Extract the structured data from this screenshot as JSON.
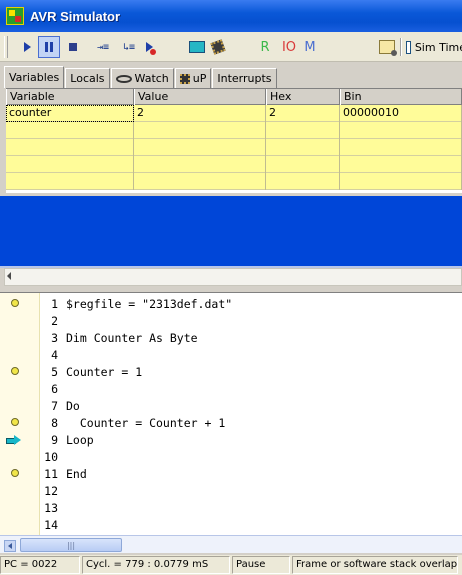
{
  "window": {
    "title": "AVR Simulator"
  },
  "toolbar": {
    "register_label": "R",
    "io_label": "IO",
    "memory_label": "M",
    "sim_time_label": "Sim Time"
  },
  "tabs": [
    {
      "label": "Variables"
    },
    {
      "label": "Locals"
    },
    {
      "label": "Watch"
    },
    {
      "label": "uP"
    },
    {
      "label": "Interrupts"
    }
  ],
  "grid": {
    "headers": [
      "Variable",
      "Value",
      "Hex",
      "Bin"
    ],
    "rows": [
      [
        "counter",
        "2",
        "2",
        "00000010"
      ]
    ]
  },
  "code": {
    "lines": [
      {
        "num": "1",
        "text": "$regfile = \"2313def.dat\""
      },
      {
        "num": "2",
        "text": ""
      },
      {
        "num": "3",
        "text": "Dim Counter As Byte"
      },
      {
        "num": "4",
        "text": ""
      },
      {
        "num": "5",
        "text": "Counter = 1"
      },
      {
        "num": "6",
        "text": ""
      },
      {
        "num": "7",
        "text": "Do"
      },
      {
        "num": "8",
        "text": "  Counter = Counter + 1"
      },
      {
        "num": "9",
        "text": "Loop"
      },
      {
        "num": "10",
        "text": ""
      },
      {
        "num": "11",
        "text": "End"
      },
      {
        "num": "12",
        "text": ""
      },
      {
        "num": "13",
        "text": ""
      },
      {
        "num": "14",
        "text": ""
      }
    ]
  },
  "statusbar": {
    "pc": "PC = 0022",
    "cycles": "Cycl. = 779 : 0.0779 mS",
    "state": "Pause",
    "message": "Frame or software stack overlap"
  },
  "colors": {
    "grid_row_bg": "#fffc99",
    "blue_area": "#0046d8"
  }
}
